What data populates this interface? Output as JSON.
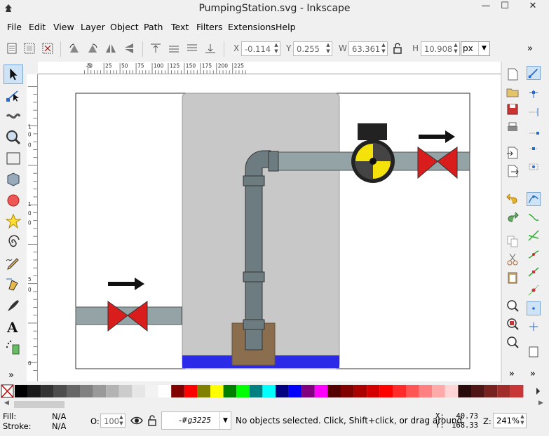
{
  "window": {
    "title": "PumpingStation.svg - Inkscape",
    "minimize": "—",
    "maximize": "☐",
    "close": "✕"
  },
  "menu": [
    "File",
    "Edit",
    "View",
    "Layer",
    "Object",
    "Path",
    "Text",
    "Filters",
    "Extensions",
    "Help"
  ],
  "toolbar": {
    "x_label": "X",
    "x_value": "-0.114",
    "y_label": "Y",
    "y_value": "0.255",
    "w_label": "W",
    "w_value": "63.361",
    "h_label": "H",
    "h_value": "10.908",
    "unit": "px",
    "overflow": "»"
  },
  "ruler_top": [
    "-5",
    "0",
    "25",
    "50",
    "75",
    "100",
    "125",
    "150",
    "175",
    "200",
    "225"
  ],
  "ruler_left": [
    "1",
    "0",
    "0",
    "1",
    "0",
    "0",
    "5",
    "0",
    "0"
  ],
  "palette_colors": [
    "#000000",
    "#1a1a1a",
    "#333333",
    "#4d4d4d",
    "#666666",
    "#808080",
    "#999999",
    "#b3b3b3",
    "#cccccc",
    "#e6e6e6",
    "#f2f2f2",
    "#ffffff",
    "#800000",
    "#ff0000",
    "#808000",
    "#ffff00",
    "#008000",
    "#00ff00",
    "#008080",
    "#00ffff",
    "#000080",
    "#0000ff",
    "#800080",
    "#ff00ff",
    "#550000",
    "#800000",
    "#aa0000",
    "#d40000",
    "#ff0000",
    "#ff2a2a",
    "#ff5555",
    "#ff8080",
    "#ffaaaa",
    "#ffd5d5",
    "#280b0b",
    "#501616",
    "#782121",
    "#a02c2c",
    "#c83737"
  ],
  "status": {
    "fill_label": "Fill:",
    "fill_value": "N/A",
    "stroke_label": "Stroke:",
    "stroke_value": "N/A",
    "opacity_label": "O:",
    "opacity_value": "100",
    "layer": "-#g3225",
    "message": "No objects selected. Click, Shift+click, or drag around",
    "cursor_x_label": "X:",
    "cursor_x": "40.73",
    "cursor_y_label": "Y:",
    "cursor_y": "168.33",
    "zoom_label": "Z:",
    "zoom": "241%"
  }
}
